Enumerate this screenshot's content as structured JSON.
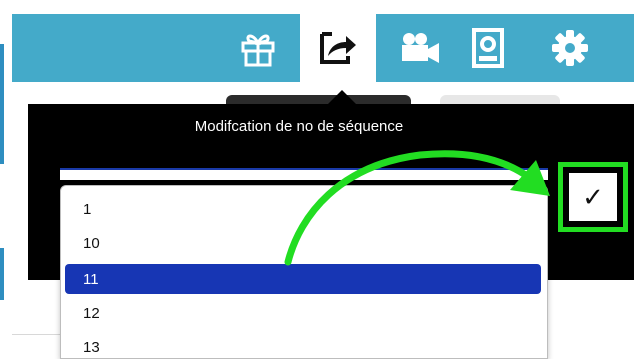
{
  "toolbar": {
    "icons": [
      {
        "name": "gift-icon",
        "active": false
      },
      {
        "name": "share-export-icon",
        "active": true
      },
      {
        "name": "video-camera-icon",
        "active": false
      },
      {
        "name": "contact-badge-icon",
        "active": false
      },
      {
        "name": "gear-icon",
        "active": false
      }
    ],
    "background_color": "#44aac9"
  },
  "popup": {
    "title": "Modifcation de no de séquence",
    "confirm_button_symbol": "✓",
    "confirm_highlight_color": "#22dd22"
  },
  "dropdown": {
    "options": [
      "1",
      "10",
      "11",
      "12",
      "13"
    ],
    "selected_value": "11",
    "selected_color": "#1736b4"
  },
  "annotation": {
    "arrow_color": "#22dd22"
  }
}
